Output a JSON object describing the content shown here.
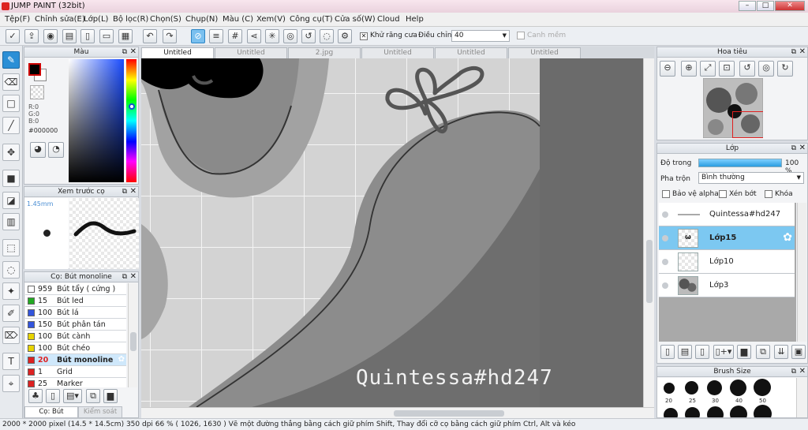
{
  "title": "JUMP PAINT (32bit)",
  "menu": [
    "Tệp(F)",
    "Chỉnh sửa(E)",
    "Lớp(L)",
    "Bộ lọc(R)",
    "Chọn(S)",
    "Chụp(N)",
    "Màu (C)",
    "Xem(V)",
    "Công cụ(T)",
    "Cửa số(W)",
    "Cloud",
    "Help"
  ],
  "toolbar": {
    "antialias_label": "Khử răng cưa",
    "adjust_label": "Điều chỉnh",
    "adjust_value": "40",
    "snap_label": "Canh mềm"
  },
  "color_panel": {
    "title": "Màu",
    "r": "R:0",
    "g": "G:0",
    "b": "B:0",
    "hex": "#000000"
  },
  "brush_preview": {
    "title": "Xem trước cọ",
    "size": "1.45mm"
  },
  "brush_panel": {
    "title": "Cọ: Bút monoline",
    "items": [
      {
        "size": "959",
        "name": "Bút tẩy ( cứng )",
        "color": "#ffffff"
      },
      {
        "size": "15",
        "name": "Bút led",
        "color": "#22aa22"
      },
      {
        "size": "100",
        "name": "Bút lá",
        "color": "#3355dd"
      },
      {
        "size": "150",
        "name": "Bút phân tán",
        "color": "#3355dd"
      },
      {
        "size": "100",
        "name": "Bút cành",
        "color": "#e8d400"
      },
      {
        "size": "100",
        "name": "Bút chéo",
        "color": "#e8d400"
      },
      {
        "size": "20",
        "name": "Bút monoline",
        "color": "#dd2222"
      },
      {
        "size": "1",
        "name": "Grid",
        "color": "#dd2222"
      },
      {
        "size": "25",
        "name": "Marker",
        "color": "#dd2222"
      }
    ],
    "tab1": "Cọ: Bút monoline",
    "tab2": "Kiểm soát cọ"
  },
  "tabs": [
    "Untitled",
    "Untitled",
    "2.jpg",
    "Untitled",
    "Untitled",
    "Untitled"
  ],
  "canvas": {
    "watermark": "Quintessa#hd247"
  },
  "navigator": {
    "title": "Hoa tiêu"
  },
  "layer_panel": {
    "title": "Lớp",
    "opacity_label": "Độ trong",
    "opacity_value": "100 %",
    "opacity": 1.0,
    "blend_label": "Pha trộn",
    "blend_value": "Bình thường",
    "protect_alpha": "Bảo vệ alpha",
    "clip": "Xén bớt",
    "lock": "Khóa",
    "layers": [
      "Quintessa#hd247",
      "Lớp15",
      "Lớp10",
      "Lớp3"
    ]
  },
  "brush_size": {
    "title": "Brush Size",
    "labels": [
      "20",
      "25",
      "30",
      "40",
      "50"
    ]
  },
  "status": "2000 * 2000 pixel   (14.5 * 14.5cm)   350 dpi   66 %   ( 1026, 1630 )   Vẽ một đường thẳng bằng cách giữ phím Shift, Thay đổi cỡ cọ bằng cách giữ phím Ctrl, Alt và kéo",
  "colors": {
    "accent": "#2b8fd6",
    "selected_layer": "#7cc8f1"
  }
}
